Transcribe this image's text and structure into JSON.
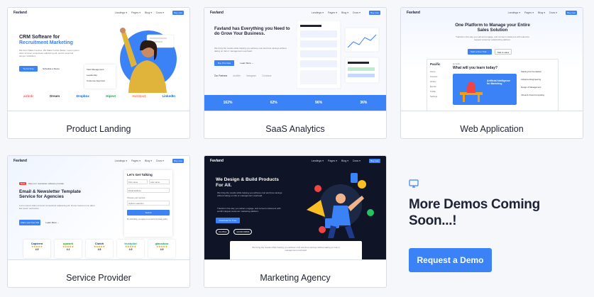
{
  "colors": {
    "accent": "#3b82f6",
    "dark_bg": "#0f1426",
    "heading": "#1e2235"
  },
  "nav": {
    "logo": "Favland",
    "links": [
      "Landings ▾",
      "Pages ▾",
      "Blog ▾",
      "Docs ▾"
    ],
    "button": "Buy now"
  },
  "cards": [
    {
      "label": "Product Landing",
      "title": "CRM Softeare for",
      "title_highlight": "Recruitment Marketing",
      "text": "We Don't Make Invoices. We Make Invoice Better. Lorem ipsum dolor sit amet consectetur adipiscing elit, sed do eiusmod tempor incididunt.",
      "btn_primary": "Try for Free",
      "btn_secondary": "Schedule a Demo",
      "checklist": [
        "Task Management",
        "Leadership",
        "Customer Approval"
      ],
      "logos": [
        "airbnb",
        "Dream",
        "Dropbox",
        "Hipext",
        "HubSpot",
        "LinkedIn"
      ]
    },
    {
      "label": "SaaS Analytics",
      "title": "Favland has Everything you Need to do Grow Your Business.",
      "text": "We bring the results while helping you achieve cost and time savings without taking on risk or management overhead.",
      "btn_primary": "Buy This Now",
      "btn_secondary": "Learn More →",
      "partners": [
        "Our Partners",
        "Audible",
        "Instagram",
        "Coinbase"
      ],
      "stats": [
        "162%",
        "62%",
        "96%",
        "36%"
      ]
    },
    {
      "label": "Web Application",
      "title": "One Platform to Manage your Entire Sales Solution",
      "text": "Transform the way you sell and engage, and connect customers with real-time support customer relationship platform.",
      "btn_primary": "Start a Free Trial →",
      "btn_secondary": "Talk to sales",
      "app_name": "Pacific",
      "app_greeting": "Hi Jack,",
      "app_question": "What will you learn today?",
      "app_banner": "Artificial Intelligence for Marketing",
      "sidebar_items": [
        "Home",
        "Courses",
        "Library",
        "Events",
        "Profile",
        "Settings"
      ],
      "list_items": [
        "Starting the Foundation",
        "Advanced Engineering",
        "Design & Management",
        "Virtual & Cloud Computing"
      ]
    },
    {
      "label": "Service Provider",
      "tag": "New",
      "tag_text": "Meet our newsletter software provider",
      "title": "Email & Newsletter Template Service for Agencies",
      "text": "Lorem ipsum dolor sit amet consectetur adipiscing elit. Donec laoreet nunc diam. Est ipsum sed lectus.",
      "btn_primary": "Claim your free trial",
      "btn_secondary": "Learn More →",
      "form_title": "Let's Get Talking",
      "form_fields": [
        "First name",
        "Last name",
        "Email address",
        "Choose your service",
        "Options selection"
      ],
      "form_submit": "Submit",
      "form_note": "By submitting, you agree to our terms & privacy policy",
      "reviews": [
        {
          "name": "Capterra",
          "rating": "4.5"
        },
        {
          "name": "upwork",
          "rating": "4.2"
        },
        {
          "name": "Clutch",
          "rating": "4.8"
        },
        {
          "name": "trustpilot",
          "rating": "4.9"
        },
        {
          "name": "glassdoor",
          "rating": "4.5"
        }
      ]
    },
    {
      "label": "Marketing Agency",
      "title": "We Design & Build Products For All.",
      "text": "We bring the results while helping you achieve cost and time savings without taking on risk or management overhead.",
      "text2": "Transform the way you attract, engage, and convert customers with world's largest customer marketing platform.",
      "btn_primary": "Download for Free",
      "badges": [
        "CLUTCH",
        "GOOD FIRMS"
      ],
      "footer_text": "We bring the results while helping you achieve cost and time savings without taking on risk or management overhead."
    }
  ],
  "more": {
    "title": "More Demos Coming Soon...!",
    "button": "Request a Demo"
  }
}
